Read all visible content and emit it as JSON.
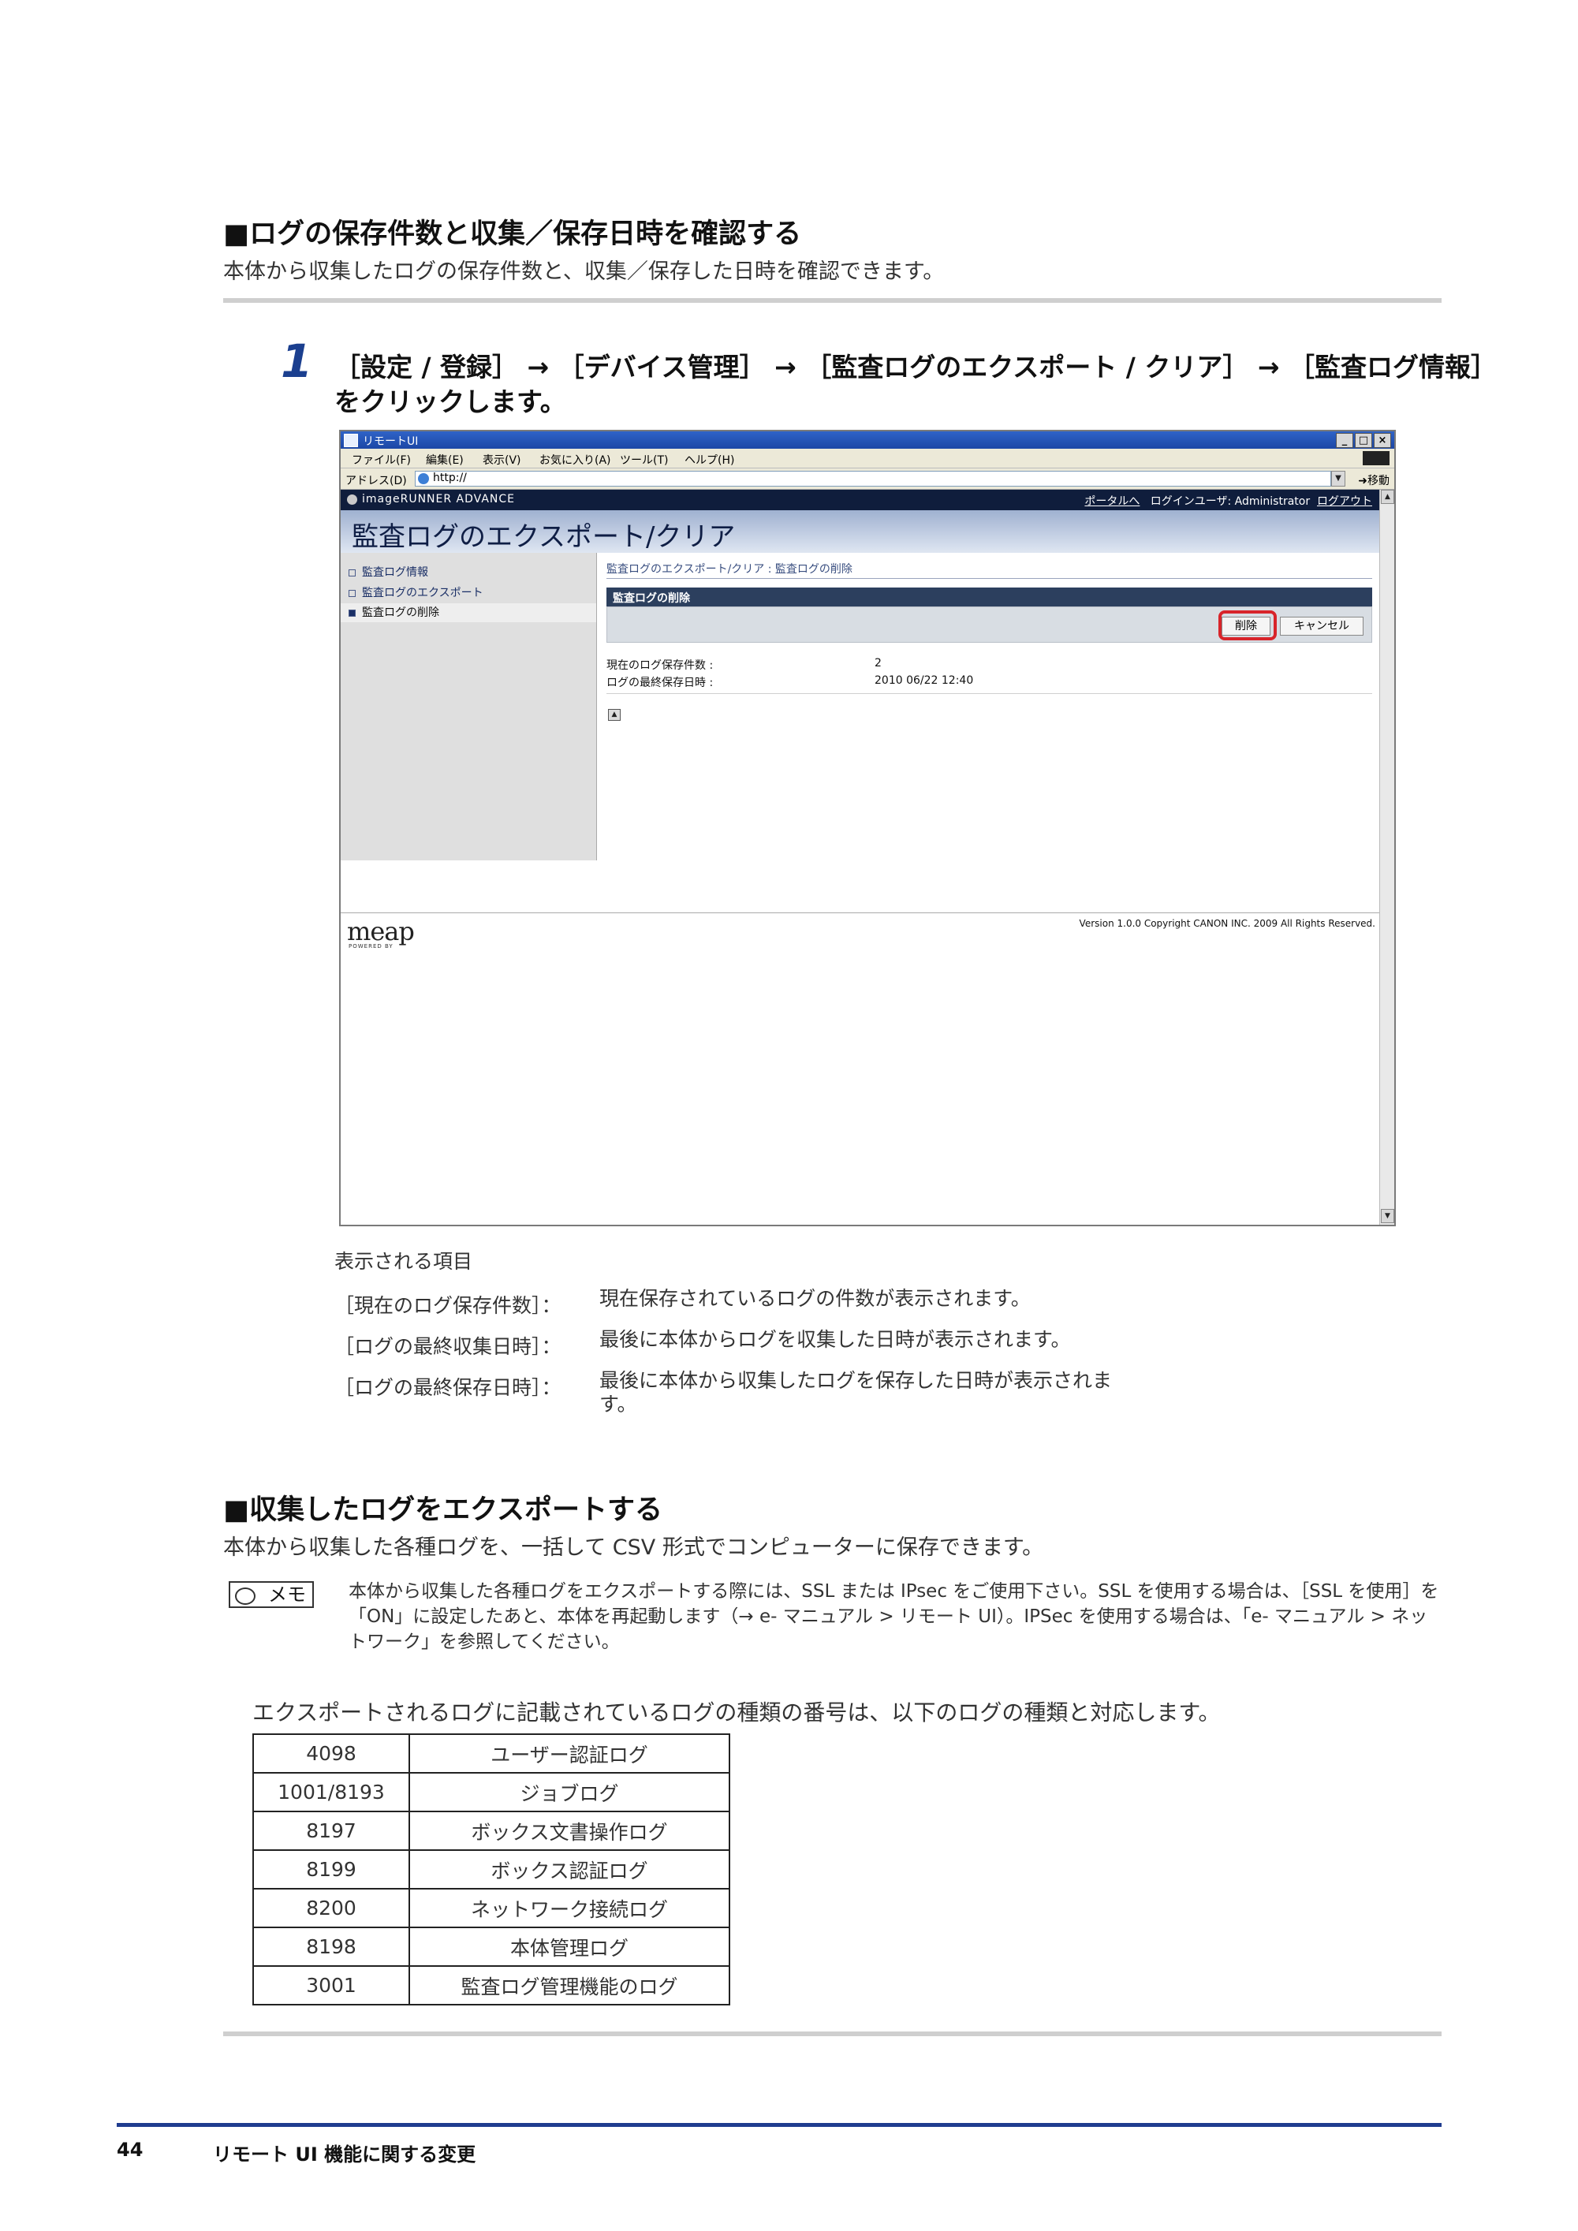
{
  "section1": {
    "title": "■ログの保存件数と収集／保存日時を確認する",
    "desc": "本体から収集したログの保存件数と、収集／保存した日時を確認できます。"
  },
  "step1": {
    "number": "1",
    "line1": "［設定 / 登録］ → ［デバイス管理］ → ［監査ログのエクスポート / クリア］ → ［監査ログ情報］",
    "line2": "をクリックします。"
  },
  "screenshot": {
    "window_title": "リモートUI",
    "menu": [
      "ファイル(F)",
      "編集(E)",
      "表示(V)",
      "お気に入り(A)",
      "ツール(T)",
      "ヘルプ(H)"
    ],
    "address_label": "アドレス(D)",
    "address_value": "http://",
    "go_label": "移動",
    "brand": "imageRUNNER ADVANCE",
    "portal_link": "ポータルへ",
    "login_user": "ログインユーザ: Administrator",
    "logout_link": "ログアウト",
    "page_title": "監査ログのエクスポート/クリア",
    "sidebar": [
      "監査ログ情報",
      "監査ログのエクスポート",
      "監査ログの削除"
    ],
    "breadcrumb": "監査ログのエクスポート/クリア : 監査ログの削除",
    "panel_title": "監査ログの削除",
    "delete_button": "削除",
    "cancel_button": "キャンセル",
    "info": [
      {
        "label": "現在のログ保存件数 :",
        "value": "2"
      },
      {
        "label": "ログの最終保存日時 :",
        "value": "2010 06/22 12:40"
      }
    ],
    "meap_logo": "meap",
    "meap_sub": "POWERED BY",
    "version": "Version 1.0.0 Copyright CANON INC. 2009 All Rights Reserved."
  },
  "items": {
    "heading": "表示される項目",
    "list": [
      {
        "key": "［現在のログ保存件数］：",
        "value": "現在保存されているログの件数が表示されます。"
      },
      {
        "key": "［ログの最終収集日時］：",
        "value": "最後に本体からログを収集した日時が表示されます。"
      },
      {
        "key": "［ログの最終保存日時］：",
        "value": "最後に本体から収集したログを保存した日時が表示されます。"
      }
    ]
  },
  "section2": {
    "title": "■収集したログをエクスポートする",
    "desc": "本体から収集した各種ログを、一括して CSV 形式でコンピューターに保存できます。"
  },
  "memo": {
    "badge": "メモ",
    "text": "本体から収集した各種ログをエクスポートする際には、SSL または IPsec をご使用下さい。SSL を使用する場合は、［SSL を使用］を「ON」に設定したあと、本体を再起動します（→ e- マニュアル > リモート UI）。IPSec を使用する場合は、「e- マニュアル > ネットワーク」を参照してください。"
  },
  "table_intro": "エクスポートされるログに記載されているログの種類の番号は、以下のログの種類と対応します。",
  "log_table": [
    [
      "4098",
      "ユーザー認証ログ"
    ],
    [
      "1001/8193",
      "ジョブログ"
    ],
    [
      "8197",
      "ボックス文書操作ログ"
    ],
    [
      "8199",
      "ボックス認証ログ"
    ],
    [
      "8200",
      "ネットワーク接続ログ"
    ],
    [
      "8198",
      "本体管理ログ"
    ],
    [
      "3001",
      "監査ログ管理機能のログ"
    ]
  ],
  "footer": {
    "page_number": "44",
    "title": "リモート UI 機能に関する変更"
  }
}
